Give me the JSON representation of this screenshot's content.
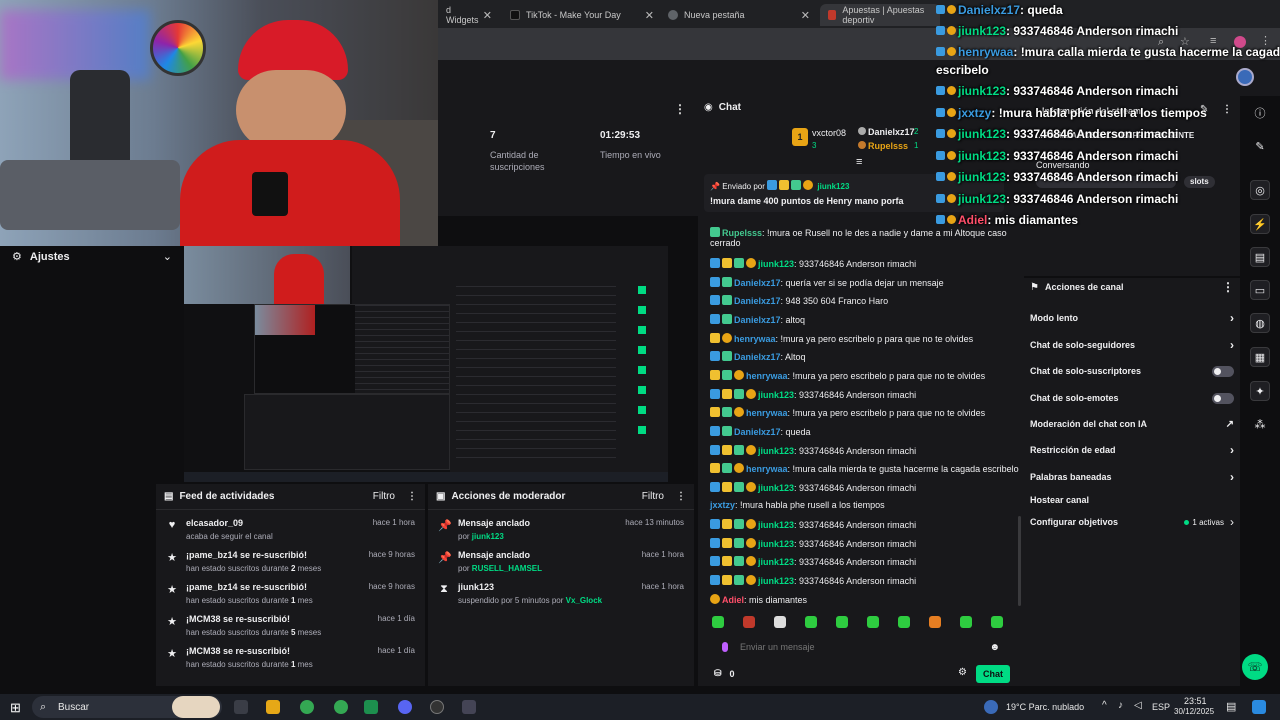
{
  "browser": {
    "tabs": [
      {
        "label": "d Widgets",
        "fav": "#8b5cf6"
      },
      {
        "label": "TikTok - Make Your Day",
        "fav": "#111111"
      },
      {
        "label": "Nueva pestaña",
        "fav": "#5f6368"
      },
      {
        "label": "Apuestas | Apuestas deportiv",
        "fav": "#c0392b"
      }
    ]
  },
  "stats": [
    {
      "value": "7",
      "label": "Cantidad de suscripciones"
    },
    {
      "value": "01:29:53",
      "label": "Tiempo en vivo"
    }
  ],
  "ajustes": {
    "label": "Ajustes"
  },
  "activity_feed": {
    "title": "Feed de actividades",
    "filter": "Filtro",
    "items": [
      {
        "icon": "heart-icon",
        "title": "elcasador_09",
        "sub": "acaba de seguir el canal",
        "time": "hace 1 hora"
      },
      {
        "icon": "star-icon",
        "title": "¡pame_bz14 se re-suscribió!",
        "sub_pre": "han estado suscritos durante ",
        "sub_bold": "2",
        "sub_post": " meses",
        "time": "hace 9 horas"
      },
      {
        "icon": "star-icon",
        "title": "¡pame_bz14 se re-suscribió!",
        "sub_pre": "han estado suscritos durante ",
        "sub_bold": "1",
        "sub_post": " mes",
        "time": "hace 9 horas"
      },
      {
        "icon": "star-icon",
        "title": "¡MCM38 se re-suscribió!",
        "sub_pre": "han estado suscritos durante ",
        "sub_bold": "5",
        "sub_post": " meses",
        "time": "hace 1 día"
      },
      {
        "icon": "star-icon",
        "title": "¡MCM38 se re-suscribió!",
        "sub_pre": "han estado suscritos durante ",
        "sub_bold": "1",
        "sub_post": " mes",
        "time": "hace 1 día"
      }
    ]
  },
  "mod_actions": {
    "title": "Acciones de moderador",
    "filter": "Filtro",
    "items": [
      {
        "icon": "pin-icon",
        "title": "Mensaje anclado",
        "sub_pre": "por ",
        "sub_user": "jiunk123",
        "time": "hace 13 minutos"
      },
      {
        "icon": "pin-icon",
        "title": "Mensaje anclado",
        "sub_pre": "por ",
        "sub_user": "RUSELL_HAMSEL",
        "time": "hace 1 hora"
      },
      {
        "icon": "hourglass-icon",
        "title": "jiunk123",
        "sub_pre": "suspendido por 5 minutos por ",
        "sub_user": "Vx_Glock",
        "time": "hace 1 hora"
      }
    ]
  },
  "chat": {
    "title": "Chat",
    "top_gifters": [
      {
        "name": "vxctor08",
        "count": "3"
      },
      {
        "name": "Danielxz17",
        "count": "2"
      },
      {
        "name": "Rupelsss",
        "count": "1"
      }
    ],
    "pinned": {
      "sent_by": "Enviado por",
      "user": "jiunk123",
      "text": "!mura dame 400 puntos de Henry mano porfa"
    },
    "messages": [
      {
        "user": "Rupelsss",
        "color": "#43c98f",
        "text": ": !mura oe Rusell no le des a nadie y dame a mi Altoque caso",
        "cont": "cerrado",
        "badges": [
          "green"
        ]
      },
      {
        "user": "jiunk123",
        "color": "#00db84",
        "text": ": 933746846 Anderson rimachi",
        "badges": [
          "blue",
          "crown",
          "green",
          "gold"
        ]
      },
      {
        "user": "Danielxz17",
        "color": "#3a9be0",
        "text": ": quería ver si se podía dejar un mensaje",
        "badges": [
          "blue",
          "green"
        ]
      },
      {
        "user": "Danielxz17",
        "color": "#3a9be0",
        "text": ": 948 350 604 Franco Haro",
        "badges": [
          "blue",
          "green"
        ]
      },
      {
        "user": "Danielxz17",
        "color": "#3a9be0",
        "text": ": altoq",
        "badges": [
          "blue",
          "green"
        ]
      },
      {
        "user": "henrywaa",
        "color": "#3a9be0",
        "text": ": !mura ya pero escribelo p para que no te olvides",
        "badges": [
          "crown",
          "gold"
        ]
      },
      {
        "user": "Danielxz17",
        "color": "#3a9be0",
        "text": ": Altoq",
        "badges": [
          "blue",
          "green"
        ]
      },
      {
        "user": "henrywaa",
        "color": "#3a9be0",
        "text": ": !mura ya pero escribelo p para que no te olvides",
        "badges": [
          "crown",
          "green",
          "gold"
        ]
      },
      {
        "user": "jiunk123",
        "color": "#00db84",
        "text": ": 933746846 Anderson rimachi",
        "badges": [
          "blue",
          "crown",
          "green",
          "gold"
        ]
      },
      {
        "user": "henrywaa",
        "color": "#3a9be0",
        "text": ": !mura ya pero escribelo p para que no te olvides",
        "badges": [
          "crown",
          "green",
          "gold"
        ]
      },
      {
        "user": "Danielxz17",
        "color": "#3a9be0",
        "text": ": queda",
        "badges": [
          "blue",
          "green"
        ]
      },
      {
        "user": "jiunk123",
        "color": "#00db84",
        "text": ": 933746846 Anderson rimachi",
        "badges": [
          "blue",
          "crown",
          "green",
          "gold"
        ]
      },
      {
        "user": "henrywaa",
        "color": "#3a9be0",
        "text": ": !mura calla mierda te gusta hacerme la cagada escribelo",
        "badges": [
          "crown",
          "green",
          "gold"
        ]
      },
      {
        "user": "jiunk123",
        "color": "#00db84",
        "text": ": 933746846 Anderson rimachi",
        "badges": [
          "blue",
          "crown",
          "green",
          "gold"
        ]
      },
      {
        "user": "jxxtzy",
        "color": "#3a9be0",
        "text": ": !mura habla phe rusell a los tiempos",
        "badges": []
      },
      {
        "user": "jiunk123",
        "color": "#00db84",
        "text": ": 933746846 Anderson rimachi",
        "badges": [
          "blue",
          "crown",
          "green",
          "gold"
        ]
      },
      {
        "user": "jiunk123",
        "color": "#00db84",
        "text": ": 933746846 Anderson rimachi",
        "badges": [
          "blue",
          "crown",
          "green",
          "gold"
        ]
      },
      {
        "user": "jiunk123",
        "color": "#00db84",
        "text": ": 933746846 Anderson rimachi",
        "badges": [
          "blue",
          "crown",
          "green",
          "gold"
        ]
      },
      {
        "user": "jiunk123",
        "color": "#00db84",
        "text": ": 933746846 Anderson rimachi",
        "badges": [
          "blue",
          "crown",
          "green",
          "gold"
        ]
      },
      {
        "user": "Adiel",
        "color": "#ff4f6a",
        "text": ": mis diamantes",
        "badges": [
          "gold"
        ]
      }
    ],
    "input_placeholder": "Enviar un mensaje",
    "points": "0",
    "send": "Chat"
  },
  "stream_info": {
    "title": "Información del stream",
    "desc": "... FAMILIA RUSELL SIEMPRE PRESENTE",
    "category": "Conversando",
    "tag": "slots"
  },
  "channel_actions": {
    "title": "Acciones de canal",
    "rows": [
      {
        "label": "Modo lento",
        "ctrl": "chevron"
      },
      {
        "label": "Chat de solo-seguidores",
        "ctrl": "chevron"
      },
      {
        "label": "Chat de solo-suscriptores",
        "ctrl": "toggle"
      },
      {
        "label": "Chat de solo-emotes",
        "ctrl": "toggle"
      },
      {
        "label": "Moderación del chat con IA",
        "ctrl": "external"
      },
      {
        "label": "Restricción de edad",
        "ctrl": "chevron"
      },
      {
        "label": "Palabras baneadas",
        "ctrl": "chevron"
      },
      {
        "label": "Hostear canal",
        "ctrl": "none"
      },
      {
        "label": "Configurar objetivos",
        "ctrl": "goal",
        "extra": "1 activas"
      }
    ]
  },
  "overlay_chat": [
    {
      "user": "Danielxz17",
      "color": "#3a9be0",
      "text": ": queda"
    },
    {
      "user": "jiunk123",
      "color": "#00db84",
      "text": ": 933746846 Anderson rimachi"
    },
    {
      "user": "henrywaa",
      "color": "#3a9be0",
      "text": ": !mura calla mierda te gusta hacerme la cagada"
    },
    {
      "user": "",
      "color": "#ffffff",
      "text": "escribelo"
    },
    {
      "user": "jiunk123",
      "color": "#00db84",
      "text": ": 933746846 Anderson rimachi"
    },
    {
      "user": "jxxtzy",
      "color": "#3a9be0",
      "text": ": !mura habla phe rusell a los tiempos"
    },
    {
      "user": "jiunk123",
      "color": "#00db84",
      "text": ": 933746846 Anderson rimachi"
    },
    {
      "user": "jiunk123",
      "color": "#00db84",
      "text": ": 933746846 Anderson rimachi"
    },
    {
      "user": "jiunk123",
      "color": "#00db84",
      "text": ": 933746846 Anderson rimachi"
    },
    {
      "user": "jiunk123",
      "color": "#00db84",
      "text": ": 933746846 Anderson rimachi"
    },
    {
      "user": "Adiel",
      "color": "#ff4f6a",
      "text": ": mis diamantes"
    }
  ],
  "taskbar": {
    "search": "Buscar",
    "weather": "19°C  Parc. nublado",
    "lang": "ESP",
    "time": "23:51",
    "date": "30/12/2025"
  },
  "colors": {
    "accent": "#00db84",
    "bg": "#0e0e10",
    "panel": "#18181b"
  }
}
